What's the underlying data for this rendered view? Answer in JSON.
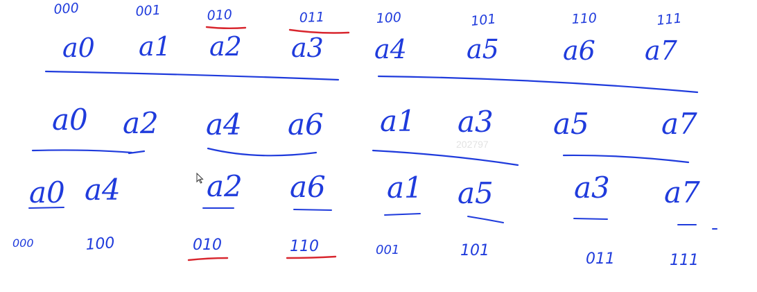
{
  "colors": {
    "ink_blue": "#1f3bdc",
    "ink_red": "#d8262e",
    "watermark": "#e3e3e3",
    "background": "#ffffff"
  },
  "rows": [
    {
      "bits": [
        "000",
        "001",
        "010",
        "011",
        "100",
        "101",
        "110",
        "111"
      ],
      "labels": [
        "a0",
        "a1",
        "a2",
        "a3",
        "a4",
        "a5",
        "a6",
        "a7"
      ],
      "highlighted_bits": [
        "010",
        "011"
      ]
    },
    {
      "labels": [
        "a0",
        "a2",
        "a4",
        "a6",
        "a1",
        "a3",
        "a5",
        "a7"
      ]
    },
    {
      "labels": [
        "a0",
        "a4",
        "a2",
        "a6",
        "a1",
        "a5",
        "a3",
        "a7"
      ],
      "bits": [
        "000",
        "100",
        "010",
        "110",
        "001",
        "101",
        "011",
        "111"
      ],
      "highlighted_bits": [
        "010",
        "110"
      ]
    }
  ],
  "watermark": "202797",
  "cursor_icon": "arrow-cursor-icon"
}
